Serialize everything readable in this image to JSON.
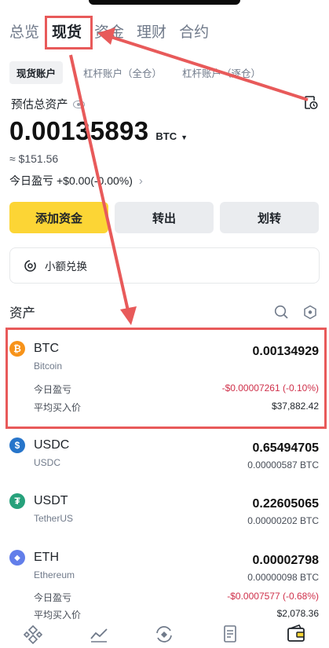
{
  "tabs": [
    "总览",
    "现货",
    "资金",
    "理财",
    "合约"
  ],
  "active_tab_index": 1,
  "subtabs": [
    "现货账户",
    "杠杆账户（全仓）",
    "杠杆账户（逐仓）"
  ],
  "summary": {
    "label": "预估总资产",
    "balance": "0.00135893",
    "unit": "BTC",
    "usd": "≈ $151.56",
    "pnl_label": "今日盈亏",
    "pnl_value": "+$0.00(-0.00%)"
  },
  "buttons": {
    "deposit": "添加资金",
    "transfer_out": "转出",
    "transfer": "划转"
  },
  "convert_label": "小额兑换",
  "assets_title": "资产",
  "assets": [
    {
      "symbol": "BTC",
      "name": "Bitcoin",
      "amount": "0.00134929",
      "btc_value": "",
      "color": "#f7931a",
      "glyph": "₿",
      "pnl_label": "今日盈亏",
      "pnl": "-$0.00007261 (-0.10%)",
      "avg_label": "平均买入价",
      "avg": "$37,882.42"
    },
    {
      "symbol": "USDC",
      "name": "USDC",
      "amount": "0.65494705",
      "btc_value": "0.00000587 BTC",
      "color": "#2775ca",
      "glyph": "$"
    },
    {
      "symbol": "USDT",
      "name": "TetherUS",
      "amount": "0.22605065",
      "btc_value": "0.00000202 BTC",
      "color": "#26a17b",
      "glyph": "₮"
    },
    {
      "symbol": "ETH",
      "name": "Ethereum",
      "amount": "0.00002798",
      "btc_value": "0.00000098 BTC",
      "color": "#627eea",
      "glyph": "◆",
      "pnl_label": "今日盈亏",
      "pnl": "-$0.0007577 (-0.68%)",
      "avg_label": "平均买入价",
      "avg": "$2,078.36"
    }
  ],
  "annotation_color": "#e85a5a",
  "accent": "#fcd535",
  "negative_color": "#cf304a"
}
